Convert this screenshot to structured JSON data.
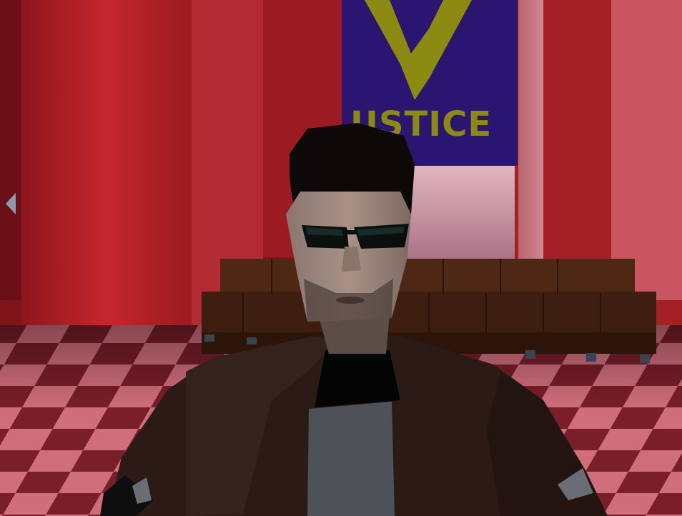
{
  "scene": {
    "banner": {
      "text": "USTICE"
    },
    "colors": {
      "wall_red": "#b0232a",
      "wall_dark": "#5e0f14",
      "pillar_red": "#c92a32",
      "floor_light": "#d8707e",
      "floor_dark": "#7a1e2a",
      "banner_purple": "#2a1670",
      "banner_yellow": "#8c8a10",
      "sky_pink": "#b88a9a",
      "bench_brown": "#4a2412",
      "jacket": "#2b1a16",
      "shirt": "#4d5258",
      "skin": "#9e8a80",
      "hair": "#0c0908",
      "sunglasses": "#0a100e"
    }
  }
}
